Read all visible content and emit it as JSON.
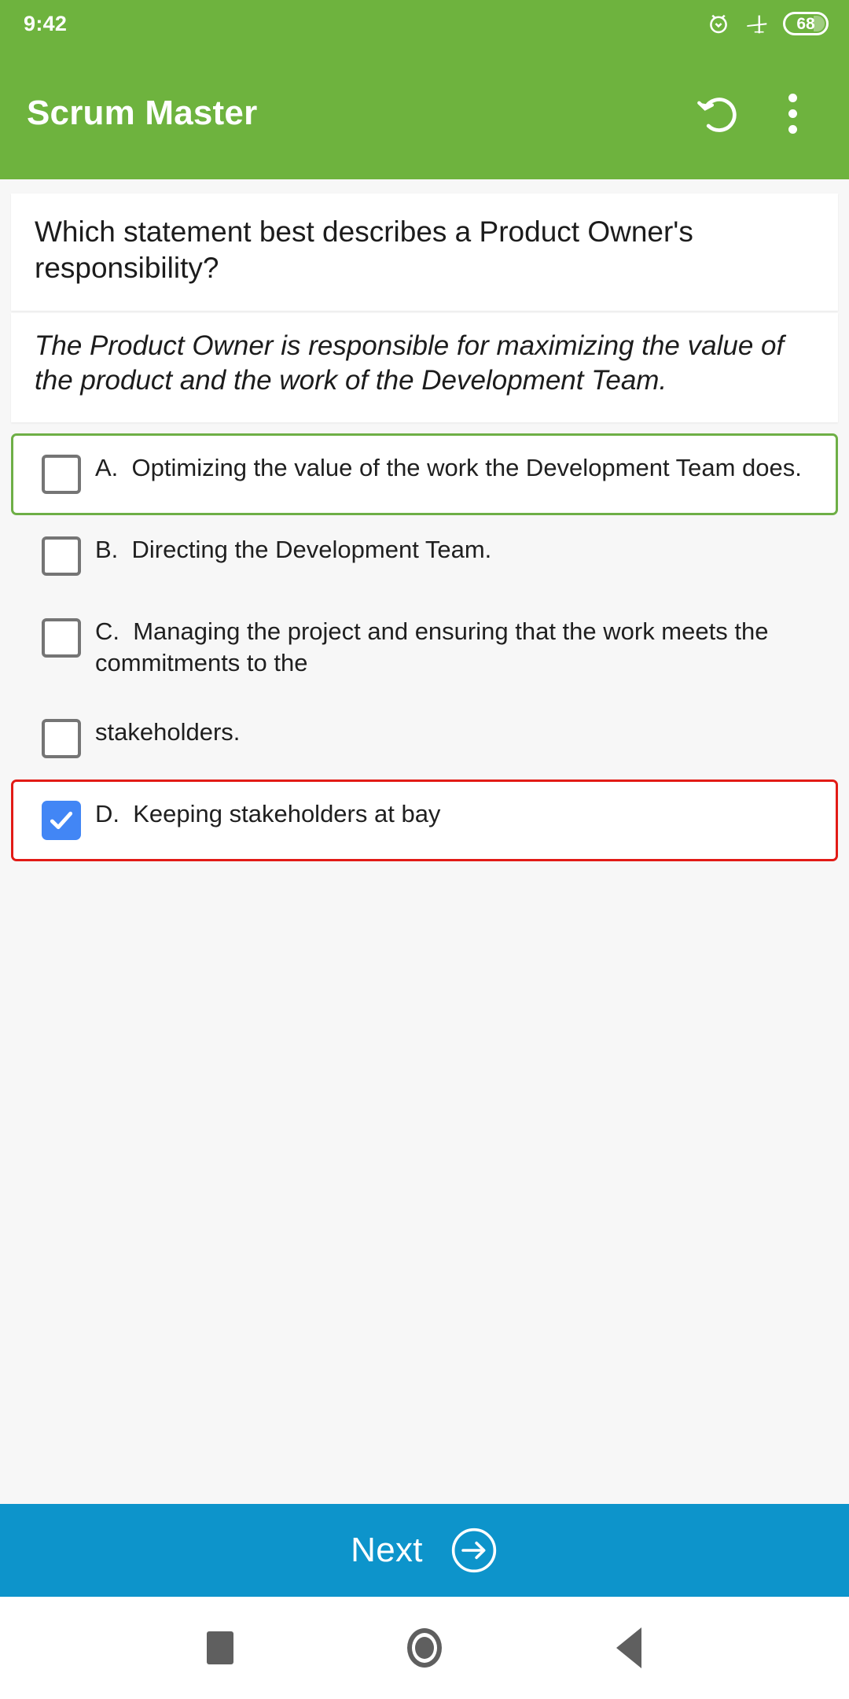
{
  "status_bar": {
    "clock": "9:42",
    "icons": [
      "alarm-icon",
      "airplane-mode-icon",
      "battery-icon"
    ],
    "battery_level": "68"
  },
  "app_bar": {
    "title": "Scrum Master",
    "restart_icon": "restart-icon",
    "overflow_icon": "more-vertical-icon",
    "background_color": "#6EB33E"
  },
  "quiz": {
    "question": "Which statement best describes a Product Owner's responsibility?",
    "explanation": "The Product Owner is responsible for maximizing the value of the product and the work of the Development Team.",
    "options": [
      {
        "label": "A.  Optimizing the value of the work the Development Team does.",
        "checked": false,
        "state": "correct",
        "border_color": "#6EAF46"
      },
      {
        "label": "B.  Directing the Development Team.",
        "checked": false,
        "state": "none",
        "border_color": ""
      },
      {
        "label": "C.  Managing the project and ensuring that the work meets the commitments to the",
        "checked": false,
        "state": "none",
        "border_color": ""
      },
      {
        "label": "stakeholders.",
        "checked": false,
        "state": "none",
        "border_color": ""
      },
      {
        "label": "D.  Keeping stakeholders at bay",
        "checked": true,
        "state": "wrong",
        "border_color": "#E21B16"
      }
    ]
  },
  "next_bar": {
    "label": "Next",
    "icon": "arrow-right-circle-icon",
    "background_color": "#0D94CB"
  },
  "nav_bar": {
    "recents_icon": "square-recents-icon",
    "home_icon": "circle-home-icon",
    "back_icon": "triangle-back-icon"
  }
}
